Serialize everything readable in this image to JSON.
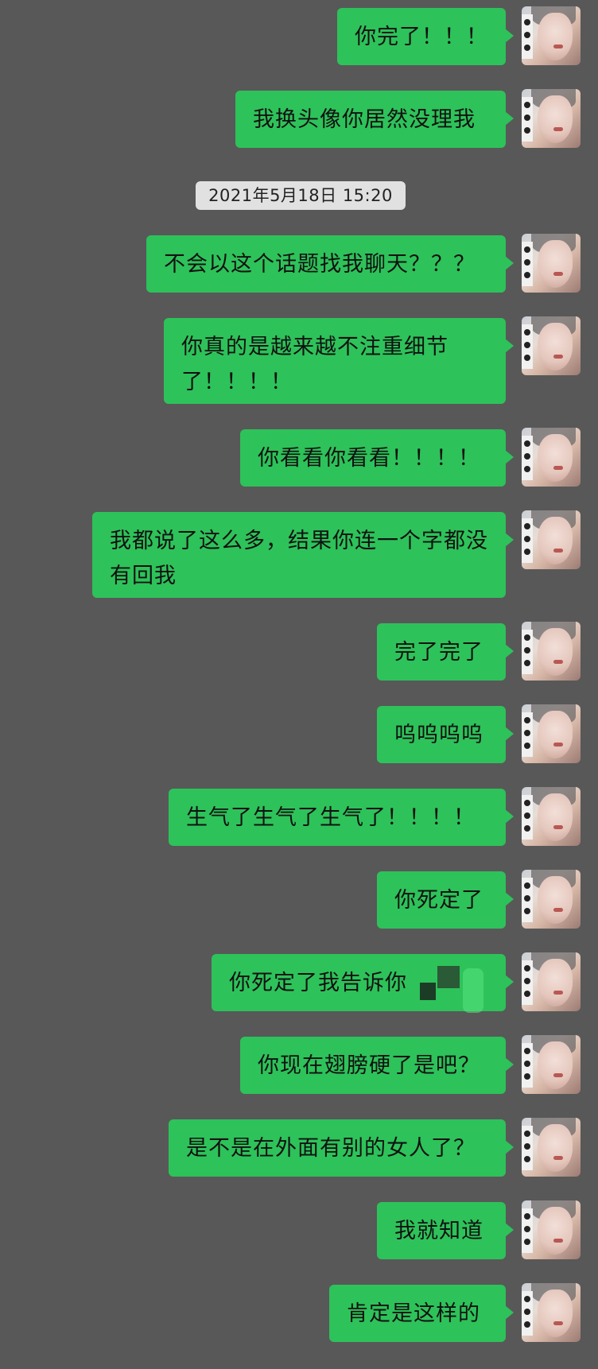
{
  "timestamp": "2021年5月18日 15:20",
  "messages": [
    {
      "text": "你完了！！！"
    },
    {
      "text": "我换头像你居然没理我"
    },
    {
      "text": "不会以这个话题找我聊天？？？"
    },
    {
      "text": "你真的是越来越不注重细节了！！！！"
    },
    {
      "text": "你看看你看看！！！！"
    },
    {
      "text": "我都说了这么多，结果你连一个字都没有回我"
    },
    {
      "text": "完了完了"
    },
    {
      "text": "呜呜呜呜"
    },
    {
      "text": "生气了生气了生气了！！！！"
    },
    {
      "text": "你死定了"
    },
    {
      "text": "你死定了我告诉你"
    },
    {
      "text": "你现在翅膀硬了是吧？"
    },
    {
      "text": "是不是在外面有别的女人了？"
    },
    {
      "text": "我就知道"
    },
    {
      "text": "肯定是这样的"
    }
  ],
  "colors": {
    "background": "#585858",
    "bubble": "#2ec25a",
    "timestamp_bg": "#e1e1e1"
  },
  "icons": {
    "avatar": "user-avatar-photo"
  }
}
